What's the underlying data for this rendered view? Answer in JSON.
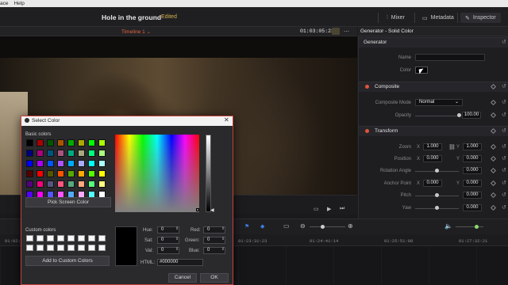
{
  "menu": [
    "ace",
    "Help"
  ],
  "project": {
    "title": "Hole in the ground",
    "status": "Edited"
  },
  "top_buttons": {
    "mixer": "Mixer",
    "metadata": "Metadata",
    "inspector": "Inspector"
  },
  "viewer": {
    "timeline": "Timeline 1",
    "timecode": "01:03:05:23"
  },
  "inspector": {
    "title": "Generator - Solid Color",
    "generator": {
      "heading": "Generator",
      "name_label": "Name",
      "name_value": "",
      "color_label": "Color"
    },
    "composite": {
      "heading": "Composite",
      "mode_label": "Composite Mode",
      "mode_value": "Normal",
      "opacity_label": "Opacity",
      "opacity_value": "100.00"
    },
    "transform": {
      "heading": "Transform",
      "zoom_label": "Zoom",
      "zoom_x": "1.000",
      "zoom_y": "1.000",
      "position_label": "Position",
      "position_x": "0.000",
      "position_y": "0.000",
      "rotation_label": "Rotation Angle",
      "rotation_value": "0.000",
      "anchor_label": "Anchor Point",
      "anchor_x": "0.000",
      "anchor_y": "0.000",
      "pitch_label": "Pitch",
      "pitch_value": "0.000",
      "yaw_label": "Yaw",
      "yaw_value": "0.000",
      "x": "X",
      "y": "Y"
    }
  },
  "timeline": {
    "ticks": [
      "01:02:2",
      "01:23:31:23",
      "01:24:41:14",
      "01:25:51:08",
      "01:27:32:21"
    ]
  },
  "dialog": {
    "title": "Select Color",
    "basic_label": "Basic colors",
    "pick_button": "Pick Screen Color",
    "custom_label": "Custom colors",
    "add_button": "Add to Custom Colors",
    "hue_label": "Hue:",
    "hue": "0",
    "sat_label": "Sat:",
    "sat": "0",
    "val_label": "Val:",
    "val": "0",
    "red_label": "Red:",
    "red": "0",
    "green_label": "Green:",
    "green": "0",
    "blue_label": "Blue:",
    "blue": "0",
    "html_label": "HTML:",
    "html": "#000000",
    "cancel": "Cancel",
    "ok": "OK",
    "basic_colors": [
      "#000000",
      "#aa0000",
      "#005500",
      "#aa5500",
      "#00aa00",
      "#aaaa00",
      "#00ff00",
      "#aaff00",
      "#00007f",
      "#aa007f",
      "#00557f",
      "#aa557f",
      "#00aa7f",
      "#aaaa7f",
      "#00ff7f",
      "#aaff7f",
      "#0000ff",
      "#aa00ff",
      "#0055ff",
      "#aa55ff",
      "#00aaff",
      "#aaaaff",
      "#00ffff",
      "#aaffff",
      "#550000",
      "#ff0000",
      "#555500",
      "#ff5500",
      "#55aa00",
      "#ffaa00",
      "#55ff00",
      "#ffff00",
      "#55007f",
      "#ff007f",
      "#55557f",
      "#ff557f",
      "#55aa7f",
      "#ffaa7f",
      "#55ff7f",
      "#ffff7f",
      "#5500ff",
      "#ff00ff",
      "#5555ff",
      "#ff55ff",
      "#55aaff",
      "#ffaaff",
      "#55ffff",
      "#ffffff"
    ]
  }
}
